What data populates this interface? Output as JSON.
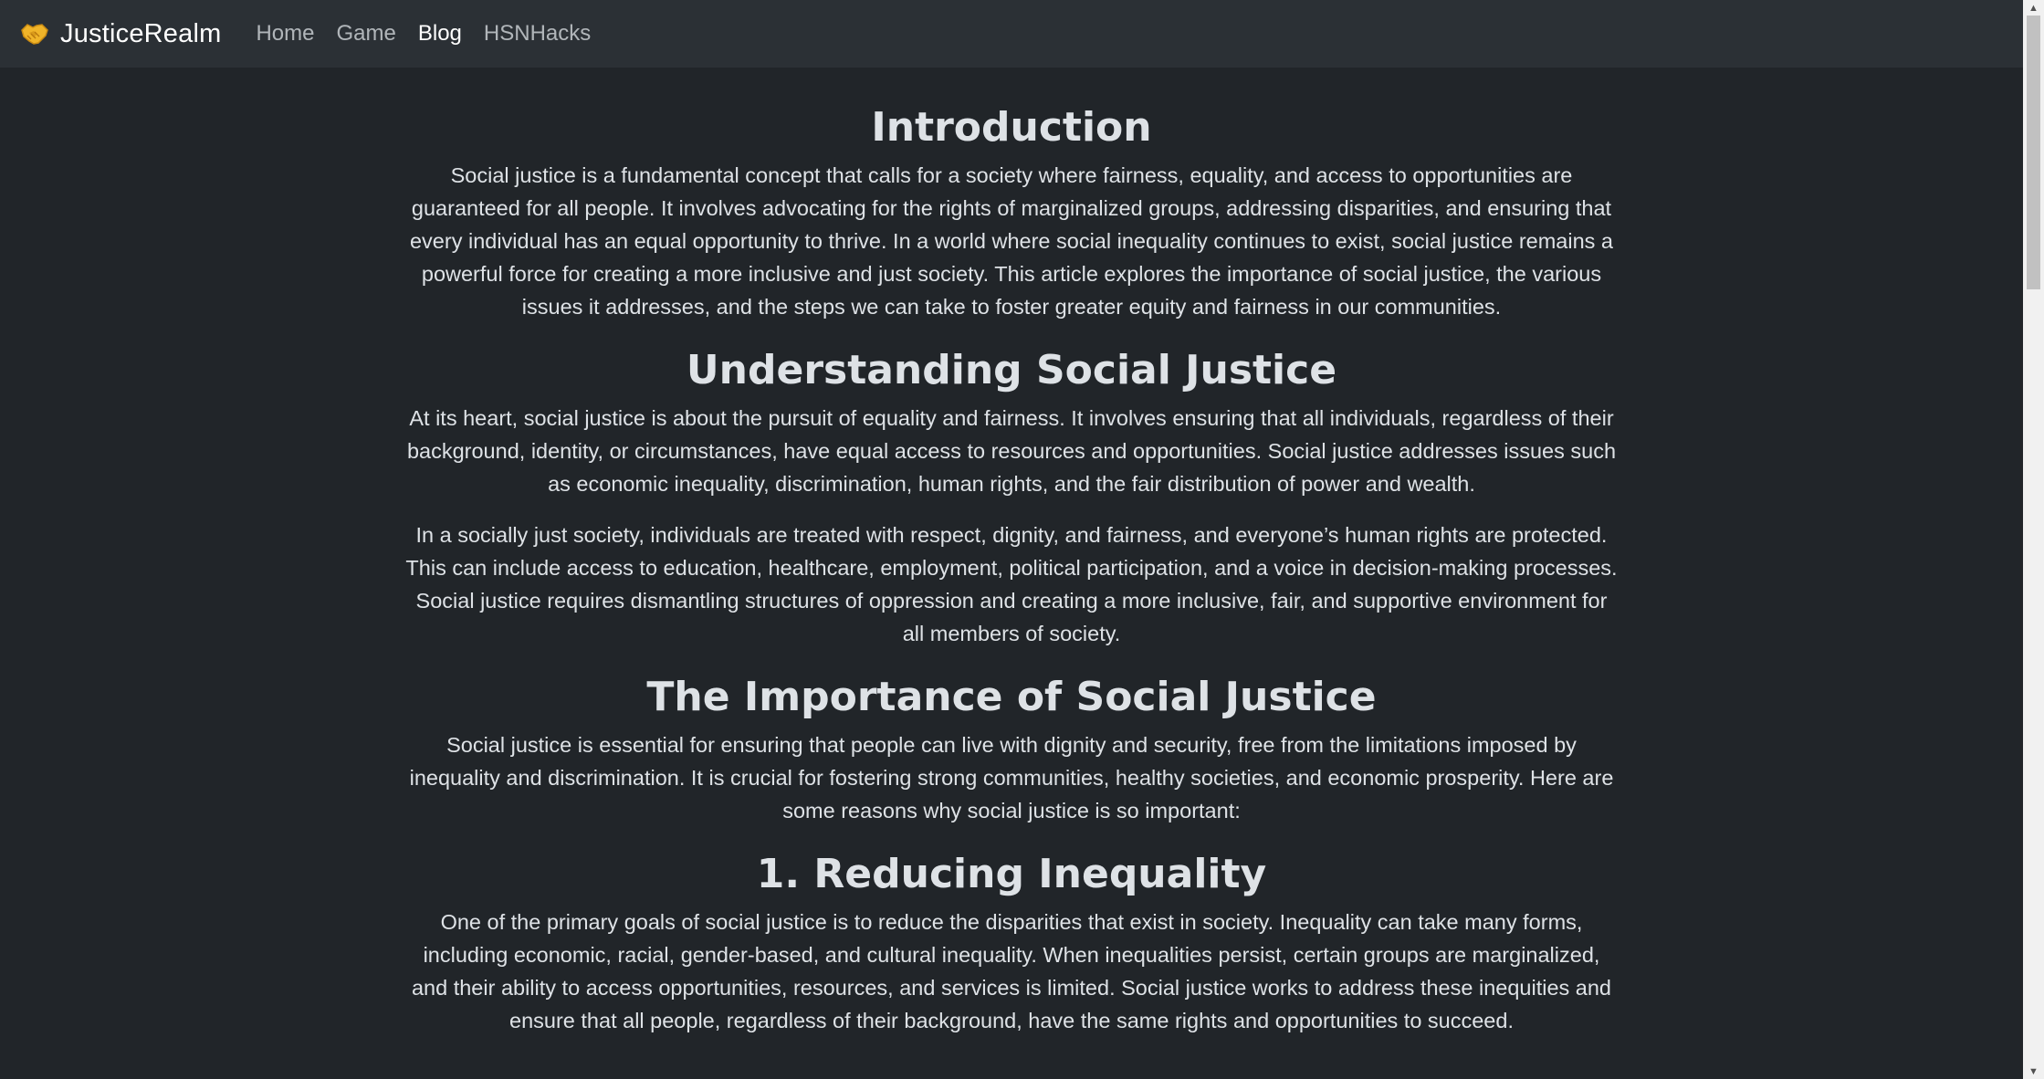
{
  "navbar": {
    "brand": "JusticeRealm",
    "brand_logo_icon": "handshake-icon",
    "brand_logo_color": "#f0b429",
    "links": [
      {
        "label": "Home",
        "active": false
      },
      {
        "label": "Game",
        "active": false
      },
      {
        "label": "Blog",
        "active": true
      },
      {
        "label": "HSNHacks",
        "active": false
      }
    ]
  },
  "article": {
    "sections": [
      {
        "heading": "Introduction",
        "paragraphs": [
          "Social justice is a fundamental concept that calls for a society where fairness, equality, and access to opportunities are guaranteed for all people. It involves advocating for the rights of marginalized groups, addressing disparities, and ensuring that every individual has an equal opportunity to thrive. In a world where social inequality continues to exist, social justice remains a powerful force for creating a more inclusive and just society. This article explores the importance of social justice, the various issues it addresses, and the steps we can take to foster greater equity and fairness in our communities."
        ]
      },
      {
        "heading": "Understanding Social Justice",
        "paragraphs": [
          "At its heart, social justice is about the pursuit of equality and fairness. It involves ensuring that all individuals, regardless of their background, identity, or circumstances, have equal access to resources and opportunities. Social justice addresses issues such as economic inequality, discrimination, human rights, and the fair distribution of power and wealth.",
          "In a socially just society, individuals are treated with respect, dignity, and fairness, and everyone’s human rights are protected. This can include access to education, healthcare, employment, political participation, and a voice in decision-making processes. Social justice requires dismantling structures of oppression and creating a more inclusive, fair, and supportive environment for all members of society."
        ]
      },
      {
        "heading": "The Importance of Social Justice",
        "paragraphs": [
          "Social justice is essential for ensuring that people can live with dignity and security, free from the limitations imposed by inequality and discrimination. It is crucial for fostering strong communities, healthy societies, and economic prosperity. Here are some reasons why social justice is so important:"
        ]
      },
      {
        "heading": "1. Reducing Inequality",
        "paragraphs": [
          "One of the primary goals of social justice is to reduce the disparities that exist in society. Inequality can take many forms, including economic, racial, gender-based, and cultural inequality. When inequalities persist, certain groups are marginalized, and their ability to access opportunities, resources, and services is limited. Social justice works to address these inequities and ensure that all people, regardless of their background, have the same rights and opportunities to succeed."
        ]
      }
    ]
  },
  "scrollbar": {
    "up_icon": "arrow-up-icon",
    "down_icon": "arrow-down-icon"
  }
}
